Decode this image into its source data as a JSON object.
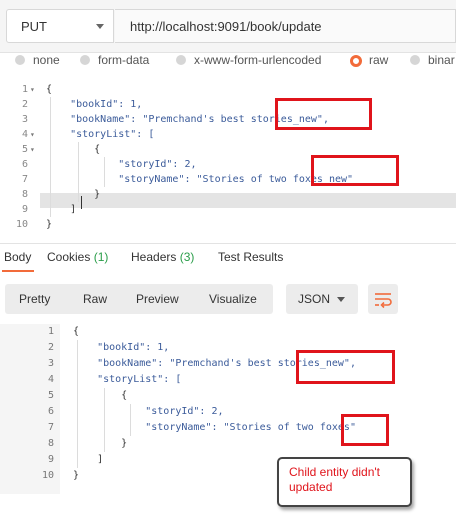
{
  "request": {
    "method": "PUT",
    "url": "http://localhost:9091/book/update"
  },
  "body_types": [
    {
      "label": "none",
      "selected": false
    },
    {
      "label": "form-data",
      "selected": false
    },
    {
      "label": "x-www-form-urlencoded",
      "selected": false
    },
    {
      "label": "raw",
      "selected": true
    },
    {
      "label": "binar",
      "selected": false
    }
  ],
  "request_body": {
    "line_numbers": [
      "1",
      "2",
      "3",
      "4",
      "5",
      "6",
      "7",
      "8",
      "9",
      "10"
    ],
    "lines": [
      "{",
      "    \"bookId\": 1,",
      "    \"bookName\": \"Premchand's best stories_new\",",
      "    \"storyList\": [",
      "        {",
      "            \"storyId\": 2,",
      "            \"storyName\": \"Stories of two foxes_new\"",
      "        }",
      "    ]",
      "}"
    ]
  },
  "response_tabs": [
    {
      "label": "Body",
      "count": ""
    },
    {
      "label": "Cookies",
      "count": "(1)"
    },
    {
      "label": "Headers",
      "count": "(3)"
    },
    {
      "label": "Test Results",
      "count": ""
    }
  ],
  "response_toolbar": {
    "views": [
      "Pretty",
      "Raw",
      "Preview",
      "Visualize"
    ],
    "format": "JSON"
  },
  "response_body": {
    "line_numbers": [
      "1",
      "2",
      "3",
      "4",
      "5",
      "6",
      "7",
      "8",
      "9",
      "10"
    ],
    "lines": [
      "{",
      "    \"bookId\": 1,",
      "    \"bookName\": \"Premchand's best stories_new\",",
      "    \"storyList\": [",
      "        {",
      "            \"storyId\": 2,",
      "            \"storyName\": \"Stories of two foxes\"",
      "        }",
      "    ]",
      "}"
    ]
  },
  "annotation": {
    "text": "Child entity didn't updated",
    "color": "#e0141b"
  },
  "colors": {
    "accent": "#f26b3a",
    "annotation_red": "#e0141b",
    "count_green": "#2a9d49"
  },
  "icons": [
    "chevron-down-icon",
    "radio-icon",
    "fold-arrow-icon",
    "wrap-lines-icon"
  ]
}
